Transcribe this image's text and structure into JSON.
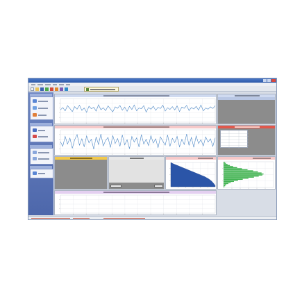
{
  "colors": {
    "title_bar": "#2d5aa8",
    "sidebar": "#5a73b6",
    "header_blue": "#cfdaf0",
    "header_pink": "#f6c9c9",
    "header_yellow": "#f2c94c",
    "header_lavender": "#e3cff0",
    "signal_line": "#4a86c5",
    "histogram_blue": "#2b55a8",
    "histogram_green": "#3fb24f",
    "gray_area": "#8c8c8c"
  },
  "icons": {
    "save": "save-icon",
    "open": "open-folder-icon",
    "people": "people-icon",
    "star": "star-icon",
    "wave": "waveform-icon"
  },
  "chart_data": [
    {
      "type": "line",
      "series": [
        {
          "values": [
            0.52,
            0.62,
            0.48,
            0.7,
            0.58,
            0.45,
            0.66,
            0.55,
            0.72,
            0.5,
            0.6,
            0.42,
            0.68,
            0.57,
            0.63,
            0.47,
            0.74,
            0.53,
            0.61,
            0.49,
            0.69,
            0.56,
            0.44,
            0.65,
            0.59,
            0.71,
            0.51,
            0.64,
            0.46,
            0.67,
            0.54,
            0.73,
            0.48,
            0.6,
            0.57,
            0.7,
            0.43,
            0.62,
            0.55,
            0.68,
            0.5,
            0.63,
            0.58,
            0.72,
            0.47,
            0.61,
            0.54,
            0.66,
            0.52,
            0.69,
            0.45,
            0.64,
            0.59,
            0.71,
            0.49,
            0.62,
            0.56,
            0.67,
            0.51,
            0.73,
            0.48,
            0.6,
            0.55,
            0.65,
            0.58,
            0.7
          ]
        }
      ],
      "ylim": [
        0,
        1
      ]
    },
    {
      "type": "line",
      "series": [
        {
          "values": [
            0.5,
            0.3,
            0.72,
            0.4,
            0.65,
            0.22,
            0.58,
            0.8,
            0.35,
            0.62,
            0.28,
            0.74,
            0.45,
            0.6,
            0.18,
            0.7,
            0.38,
            0.82,
            0.32,
            0.55,
            0.68,
            0.25,
            0.76,
            0.42,
            0.63,
            0.3,
            0.78,
            0.36,
            0.58,
            0.2,
            0.72,
            0.48,
            0.66,
            0.27,
            0.8,
            0.4,
            0.6,
            0.33,
            0.75,
            0.44,
            0.62,
            0.24,
            0.7,
            0.52,
            0.35,
            0.78,
            0.3,
            0.64,
            0.46,
            0.72,
            0.28,
            0.6,
            0.38,
            0.82,
            0.34,
            0.68,
            0.26,
            0.74,
            0.42,
            0.58,
            0.32,
            0.7,
            0.48,
            0.62,
            0.3,
            0.66
          ]
        }
      ],
      "ylim": [
        0,
        1
      ]
    },
    {
      "type": "area",
      "series": [
        {
          "values": [
            1.0,
            0.96,
            0.93,
            0.9,
            0.87,
            0.84,
            0.81,
            0.78,
            0.75,
            0.72,
            0.69,
            0.66,
            0.63,
            0.6,
            0.57,
            0.54,
            0.51,
            0.48,
            0.45,
            0.42,
            0.38,
            0.34,
            0.29,
            0.23,
            0.15,
            0.05
          ]
        }
      ],
      "ylim": [
        0,
        1
      ]
    },
    {
      "type": "bar",
      "series": [
        {
          "values": [
            0.03,
            0.06,
            0.1,
            0.16,
            0.24,
            0.34,
            0.46,
            0.6,
            0.74,
            0.86,
            0.95,
            1.0,
            0.97,
            0.88,
            0.76,
            0.62,
            0.48,
            0.36,
            0.26,
            0.18,
            0.12,
            0.07,
            0.04,
            0.02
          ]
        }
      ],
      "ylim": [
        0,
        1
      ]
    }
  ]
}
